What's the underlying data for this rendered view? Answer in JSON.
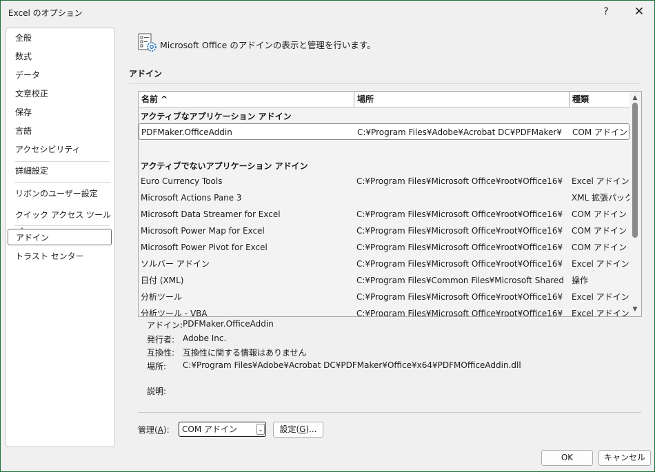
{
  "window": {
    "title": "Excel のオプション",
    "help": "?",
    "close": "✕"
  },
  "nav": {
    "items": [
      {
        "label": "全般"
      },
      {
        "label": "数式"
      },
      {
        "label": "データ"
      },
      {
        "label": "文章校正"
      },
      {
        "label": "保存"
      },
      {
        "label": "言語"
      },
      {
        "label": "アクセシビリティ"
      },
      {
        "label": "詳細設定"
      },
      {
        "label": "リボンのユーザー設定"
      },
      {
        "label": "クイック アクセス ツール バー"
      },
      {
        "label": "アドイン"
      },
      {
        "label": "トラスト センター"
      }
    ],
    "selected": "アドイン"
  },
  "main": {
    "header": "Microsoft Office のアドインの表示と管理を行います。",
    "section_title": "アドイン",
    "columns": {
      "name": "名前 ^",
      "location": "場所",
      "type": "種類"
    },
    "rows": [
      {
        "kind": "group",
        "name": "アクティブなアプリケーション アドイン",
        "location": "",
        "type": ""
      },
      {
        "kind": "item",
        "name": "PDFMaker.OfficeAddin",
        "location": "C:¥Program Files¥Adobe¥Acrobat DC¥PDFMaker¥",
        "type": "COM アドイン"
      },
      {
        "kind": "blank",
        "name": "",
        "location": "",
        "type": ""
      },
      {
        "kind": "group",
        "name": "アクティブでないアプリケーション アドイン",
        "location": "",
        "type": ""
      },
      {
        "kind": "item",
        "name": "Euro Currency Tools",
        "location": "C:¥Program Files¥Microsoft Office¥root¥Office16¥",
        "type": "Excel アドイン"
      },
      {
        "kind": "item",
        "name": "Microsoft Actions Pane 3",
        "location": "",
        "type": "XML 拡張パック"
      },
      {
        "kind": "item",
        "name": "Microsoft Data Streamer for Excel",
        "location": "C:¥Program Files¥Microsoft Office¥root¥Office16¥",
        "type": "COM アドイン"
      },
      {
        "kind": "item",
        "name": "Microsoft Power Map for Excel",
        "location": "C:¥Program Files¥Microsoft Office¥root¥Office16¥",
        "type": "COM アドイン"
      },
      {
        "kind": "item",
        "name": "Microsoft Power Pivot for Excel",
        "location": "C:¥Program Files¥Microsoft Office¥root¥Office16¥",
        "type": "COM アドイン"
      },
      {
        "kind": "item",
        "name": "ソルバー アドイン",
        "location": "C:¥Program Files¥Microsoft Office¥root¥Office16¥",
        "type": "Excel アドイン"
      },
      {
        "kind": "item",
        "name": "日付 (XML)",
        "location": "C:¥Program Files¥Common Files¥Microsoft Shared",
        "type": "操作"
      },
      {
        "kind": "item",
        "name": "分析ツール",
        "location": "C:¥Program Files¥Microsoft Office¥root¥Office16¥",
        "type": "Excel アドイン"
      },
      {
        "kind": "item",
        "name": "分析ツール - VBA",
        "location": "C:¥Program Files¥Microsoft Office¥root¥Office16¥",
        "type": "Excel アドイン"
      }
    ],
    "selected_row": "PDFMaker.OfficeAddin",
    "details": {
      "addin_label": "アドイン:",
      "addin_value": "PDFMaker.OfficeAddin",
      "publisher_label": "発行者:",
      "publisher_value": "Adobe Inc.",
      "compat_label": "互換性:",
      "compat_value": "互換性に関する情報はありません",
      "location_label": "場所:",
      "location_value": "C:¥Program Files¥Adobe¥Acrobat DC¥PDFMaker¥Office¥x64¥PDFMOfficeAddin.dll",
      "desc_label": "説明:"
    },
    "manage": {
      "label_prefix": "管理(",
      "label_key": "A",
      "label_suffix": "):",
      "selected": "COM アドイン",
      "settings_prefix": "設定(",
      "settings_key": "G",
      "settings_suffix": ")..."
    }
  },
  "footer": {
    "ok": "OK",
    "cancel": "キャンセル"
  },
  "colors": {
    "window_border": "#1e6e3a",
    "background": "#f0f0f0"
  }
}
